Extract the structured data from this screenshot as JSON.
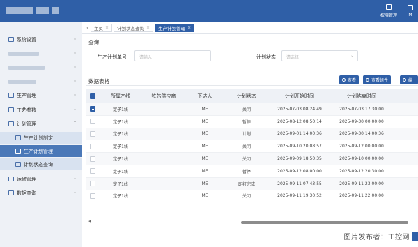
{
  "header": {
    "nav": [
      {
        "label": "权限管理",
        "icon": "permission-icon"
      },
      {
        "label": "M",
        "icon": "user-icon"
      }
    ]
  },
  "sidebar": {
    "items": [
      {
        "label": "系统设置",
        "icon": "settings-icon",
        "chevron": "⌄"
      },
      {
        "label": "",
        "icon": "",
        "chevron": "⌄"
      },
      {
        "label": "",
        "icon": "",
        "chevron": "⌄"
      },
      {
        "label": "",
        "icon": "",
        "chevron": "⌄"
      },
      {
        "label": "生产管理",
        "icon": "production-icon",
        "chevron": "⌄"
      },
      {
        "label": "工艺参数",
        "icon": "process-icon",
        "chevron": "⌄"
      },
      {
        "label": "计划管理",
        "icon": "plan-icon",
        "chevron": "⌃"
      },
      {
        "label": "生产计划制定",
        "icon": "plan-create-icon"
      },
      {
        "label": "生产计划管理",
        "icon": "plan-manage-icon"
      },
      {
        "label": "计划状态查询",
        "icon": "plan-query-icon"
      },
      {
        "label": "运修管理",
        "icon": "maintenance-icon",
        "chevron": "⌄"
      },
      {
        "label": "数据查询",
        "icon": "data-query-icon",
        "chevron": "⌄"
      }
    ]
  },
  "tabs": {
    "left_arrow": "‹",
    "items": [
      {
        "label": "主页",
        "close": "×"
      },
      {
        "label": "计划状态查询",
        "close": "×"
      },
      {
        "label": "生产计划管理",
        "close": "×"
      }
    ]
  },
  "query": {
    "title": "查询",
    "plan_no_label": "生产计划单号",
    "plan_no_placeholder": "请输入",
    "status_label": "计划状态",
    "status_placeholder": "请选择",
    "status_dropdown": "⌄"
  },
  "datatable": {
    "title": "数据表格",
    "buttons": [
      "查看",
      "查看组件",
      "编"
    ],
    "columns": [
      "",
      "所属产线",
      "铁芯供应商",
      "下达人",
      "计划状态",
      "计划开始时间",
      "计划结束时间",
      ""
    ],
    "rows": [
      {
        "checked": true,
        "line": "定子1线",
        "supplier": "",
        "issuer": "ME",
        "status": "关闭",
        "start": "2025-07-03 08:24:49",
        "end": "2025-07-03 17:30:00"
      },
      {
        "checked": false,
        "line": "定子1线",
        "supplier": "",
        "issuer": "ME",
        "status": "暂停",
        "start": "2025-08-12 08:50:14",
        "end": "2025-09-30 00:00:00"
      },
      {
        "checked": false,
        "line": "定子1线",
        "supplier": "",
        "issuer": "ME",
        "status": "计划",
        "start": "2025-09-01 14:00:36",
        "end": "2025-09-30 14:00:36"
      },
      {
        "checked": false,
        "line": "定子1线",
        "supplier": "",
        "issuer": "ME",
        "status": "关闭",
        "start": "2025-09-10 20:08:57",
        "end": "2025-09-12 00:00:00"
      },
      {
        "checked": false,
        "line": "定子1线",
        "supplier": "",
        "issuer": "ME",
        "status": "关闭",
        "start": "2025-09-09 18:50:35",
        "end": "2025-09-10 00:00:00"
      },
      {
        "checked": false,
        "line": "定子1线",
        "supplier": "",
        "issuer": "ME",
        "status": "暂停",
        "start": "2025-09-12 08:00:00",
        "end": "2025-09-12 20:30:00"
      },
      {
        "checked": false,
        "line": "定子1线",
        "supplier": "",
        "issuer": "ME",
        "status": "即将完成",
        "start": "2025-09-11 07:43:55",
        "end": "2025-09-11 23:00:00"
      },
      {
        "checked": false,
        "line": "定子1线",
        "supplier": "",
        "issuer": "ME",
        "status": "关闭",
        "start": "2025-09-11 19:30:52",
        "end": "2025-09-11 22:00:00"
      }
    ],
    "scroll_left": "◂"
  },
  "watermark": "图片发布者：工控网"
}
